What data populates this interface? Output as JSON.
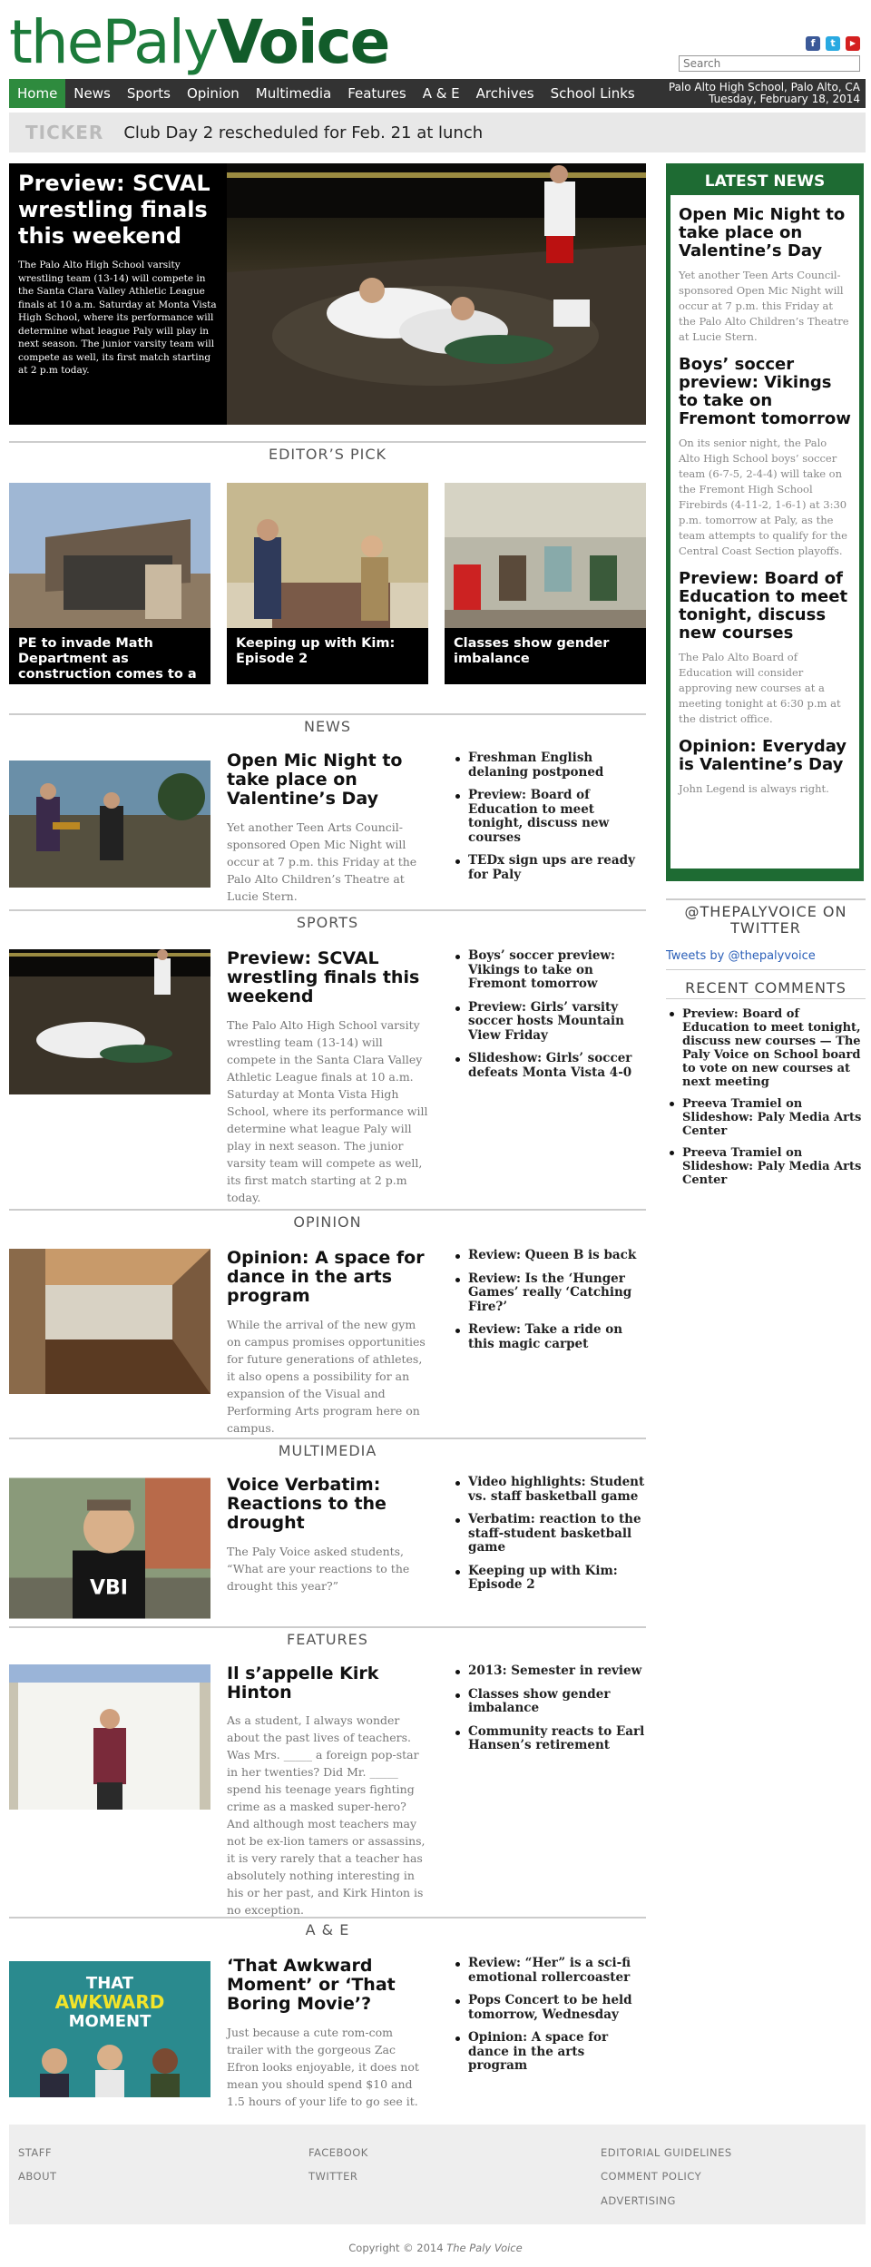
{
  "logo": {
    "part1": "the",
    "part2": "Paly",
    "part3": "Voice"
  },
  "social": [
    {
      "name": "facebook-icon",
      "glyph": "f",
      "color": "#3b5998"
    },
    {
      "name": "twitter-icon",
      "glyph": "t",
      "color": "#29a9e1"
    },
    {
      "name": "youtube-icon",
      "glyph": "▶",
      "color": "#d42020"
    }
  ],
  "search": {
    "placeholder": "Search"
  },
  "nav": {
    "items": [
      "Home",
      "News",
      "Sports",
      "Opinion",
      "Multimedia",
      "Features",
      "A & E",
      "Archives",
      "School Links"
    ],
    "location": "Palo Alto High School, Palo Alto, CA",
    "date": "Tuesday, February 18, 2014"
  },
  "ticker": {
    "label": "TICKER",
    "text": "Club Day 2 rescheduled for Feb. 21 at lunch"
  },
  "hero": {
    "title": "Preview: SCVAL wrestling finals this weekend",
    "body": "The Palo Alto High School varsity wrestling team (13-14) will compete in the Santa Clara Valley Athletic League finals at 10 a.m. Saturday at Monta Vista High School, where its performance will determine what league Paly will play in next season. The junior varsity team will compete as well, its first match starting at 2 p.m today."
  },
  "editors_pick": {
    "heading": "EDITOR’S PICK",
    "items": [
      "PE to invade Math Department as construction comes to a",
      "Keeping up with Kim: Episode 2",
      "Classes show gender imbalance"
    ]
  },
  "sections": {
    "news": {
      "heading": "NEWS",
      "title": "Open Mic Night to take place on Valentine’s Day",
      "desc": "Yet another Teen Arts Council-sponsored Open Mic Night will occur at 7 p.m. this Friday at the Palo Alto Children’s Theatre at Lucie Stern.",
      "links": [
        "Freshman English delaning postponed",
        "Preview: Board of Education to meet tonight, discuss new courses",
        "TEDx sign ups are ready for Paly"
      ]
    },
    "sports": {
      "heading": "SPORTS",
      "title": "Preview: SCVAL wrestling finals this weekend",
      "desc": "The Palo Alto High School varsity wrestling team (13-14) will compete in the Santa Clara Valley Athletic League finals at 10 a.m. Saturday at Monta Vista High School, where its performance will determine what league Paly will play in next season. The junior varsity team will compete as well, its first match starting at 2 p.m today.",
      "links": [
        "Boys’ soccer preview: Vikings to take on Fremont tomorrow",
        "Preview: Girls’ varsity soccer hosts Mountain View Friday",
        "Slideshow: Girls’ soccer defeats Monta Vista 4-0"
      ]
    },
    "opinion": {
      "heading": "OPINION",
      "title": "Opinion: A space for dance in the arts program",
      "desc": "While the arrival of the new gym on campus promises opportunities for future generations of athletes, it also opens a possibility for an expansion of the Visual and Performing Arts program here on campus.",
      "links": [
        "Review: Queen B is back",
        "Review: Is the ‘Hunger Games’ really ‘Catching Fire?’",
        "Review: Take a ride on this magic carpet"
      ]
    },
    "multimedia": {
      "heading": "MULTIMEDIA",
      "title": "Voice Verbatim: Reactions to the drought",
      "desc": "The Paly Voice asked students, “What are your reactions to the drought this year?”",
      "links": [
        "Video highlights: Student vs. staff basketball game",
        "Verbatim: reaction to the staff-student basketball game",
        "Keeping up with Kim: Episode 2"
      ]
    },
    "features": {
      "heading": "FEATURES",
      "title": "Il s’appelle Kirk Hinton",
      "desc": "As a student, I always wonder about the past lives of teachers. Was Mrs. _____ a foreign pop-star in her twenties? Did Mr. _____ spend his teenage years fighting crime as a masked super-hero? And although most teachers may not be ex-lion tamers or assassins, it is very rarely that a teacher has absolutely nothing interesting in his or her past, and Kirk Hinton is no exception.",
      "links": [
        "2013: Semester in review",
        "Classes show gender imbalance",
        "Community reacts to Earl Hansen’s retirement"
      ]
    },
    "ae": {
      "heading": "A & E",
      "title": "‘That Awkward Moment’ or ‘That Boring Movie’?",
      "desc": "Just because a cute rom-com trailer with the gorgeous Zac Efron looks enjoyable, it does not mean you should spend $10 and 1.5 hours of your life to go see it.",
      "links": [
        "Review: “Her” is a sci-fi emotional rollercoaster",
        "Pops Concert to be held tomorrow, Wednesday",
        "Opinion: A space for dance in the arts program"
      ],
      "poster_line1": "THAT",
      "poster_line2": "AWKWARD",
      "poster_line3": "MOMENT"
    }
  },
  "multimedia_shirt": "VBI",
  "latest": {
    "heading": "LATEST NEWS",
    "items": [
      {
        "title": "Open Mic Night to take place on Valentine’s Day",
        "desc": "Yet another Teen Arts Council-sponsored Open Mic Night will occur at 7 p.m. this Friday at the Palo Alto Children’s Theatre at Lucie Stern."
      },
      {
        "title": "Boys’ soccer preview: Vikings to take on Fremont tomorrow",
        "desc": "On its senior night, the Palo Alto High School boys’ soccer team (6-7-5, 2-4-4) will take on the Fremont High School Firebirds (4-11-2, 1-6-1) at 3:30 p.m. tomorrow at Paly, as the team attempts to qualify for the Central Coast Section playoffs."
      },
      {
        "title": "Preview: Board of Education to meet tonight, discuss new courses",
        "desc": "The Palo Alto Board of Education will consider approving new courses at a meeting tonight at 6:30 p.m at the district office."
      },
      {
        "title": "Opinion: Everyday is Valentine’s Day",
        "desc": "John Legend is always right."
      }
    ]
  },
  "twitter": {
    "heading": "@THEPALYVOICE ON TWITTER",
    "link": "Tweets by @thepalyvoice"
  },
  "recent_comments": {
    "heading": "RECENT COMMENTS",
    "items": [
      "Preview: Board of Education to meet tonight, discuss new courses — The Paly Voice on School board to vote on new courses at next meeting",
      "Preeva Tramiel on Slideshow: Paly Media Arts Center",
      "Preeva Tramiel on Slideshow: Paly Media Arts Center"
    ]
  },
  "footer": {
    "links": [
      "STAFF",
      "ABOUT",
      "FACEBOOK",
      "TWITTER",
      "EDITORIAL GUIDELINES",
      "COMMENT POLICY",
      "ADVERTISING"
    ],
    "copyright": "Copyright © 2014",
    "publication": "The Paly Voice"
  }
}
